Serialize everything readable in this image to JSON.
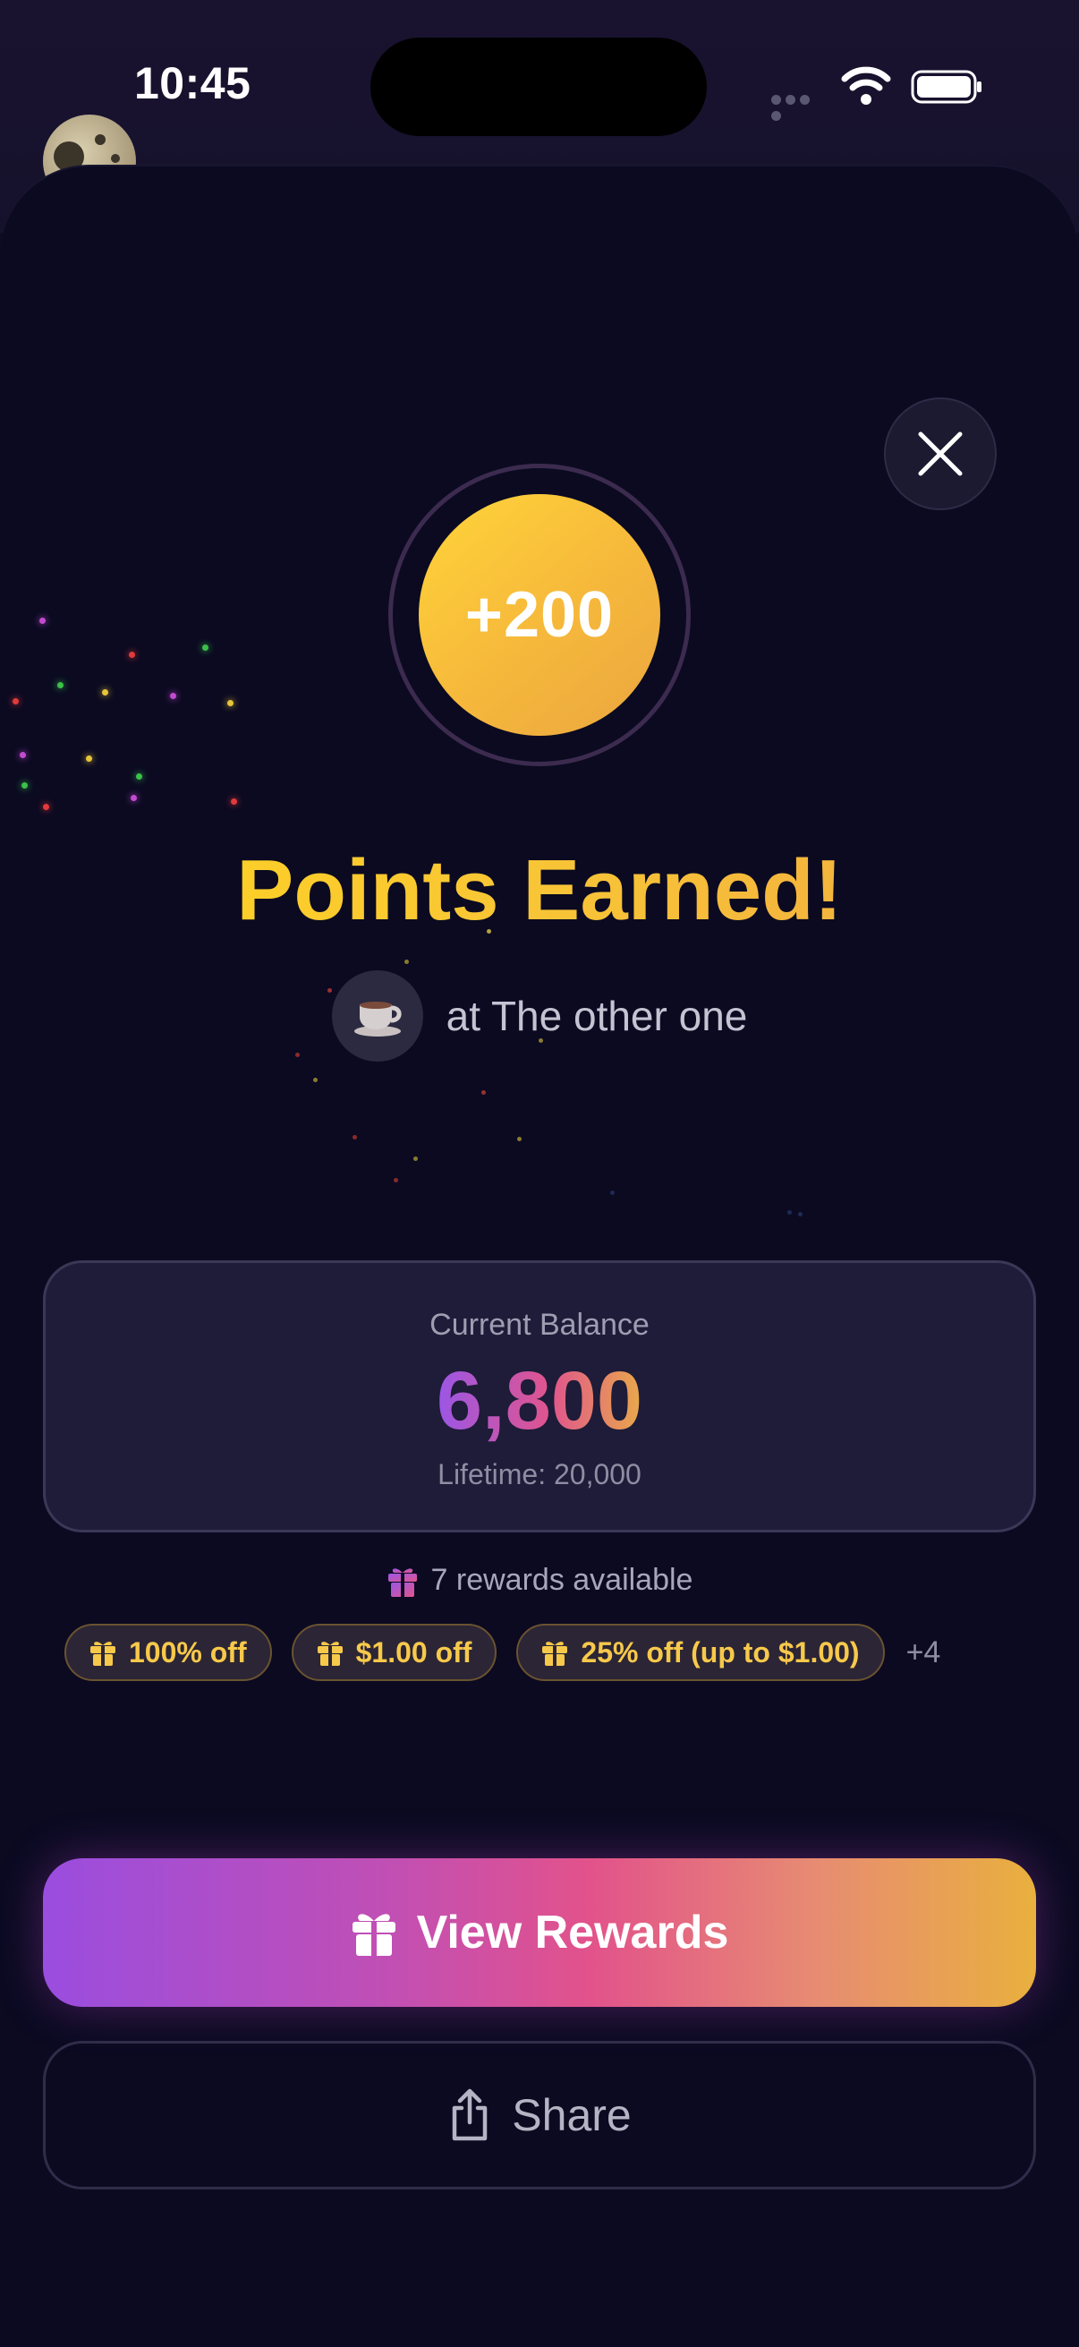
{
  "status_bar": {
    "time": "10:45"
  },
  "award": {
    "points": "+200",
    "title": "Points Earned!",
    "venue_text": "at The other one",
    "venue_icon": "coffee-cup-icon"
  },
  "balance": {
    "label": "Current Balance",
    "value": "6,800",
    "lifetime": "Lifetime: 20,000"
  },
  "rewards": {
    "available_text": "7 rewards available",
    "chips": [
      "100% off",
      "$1.00 off",
      "25% off (up to $1.00)"
    ],
    "more": "+4"
  },
  "actions": {
    "primary_label": "View Rewards",
    "secondary_label": "Share"
  },
  "colors": {
    "background": "#0b0a21",
    "gold": "#f8c536",
    "purple": "#9a4ddf",
    "pink": "#e2528b"
  }
}
